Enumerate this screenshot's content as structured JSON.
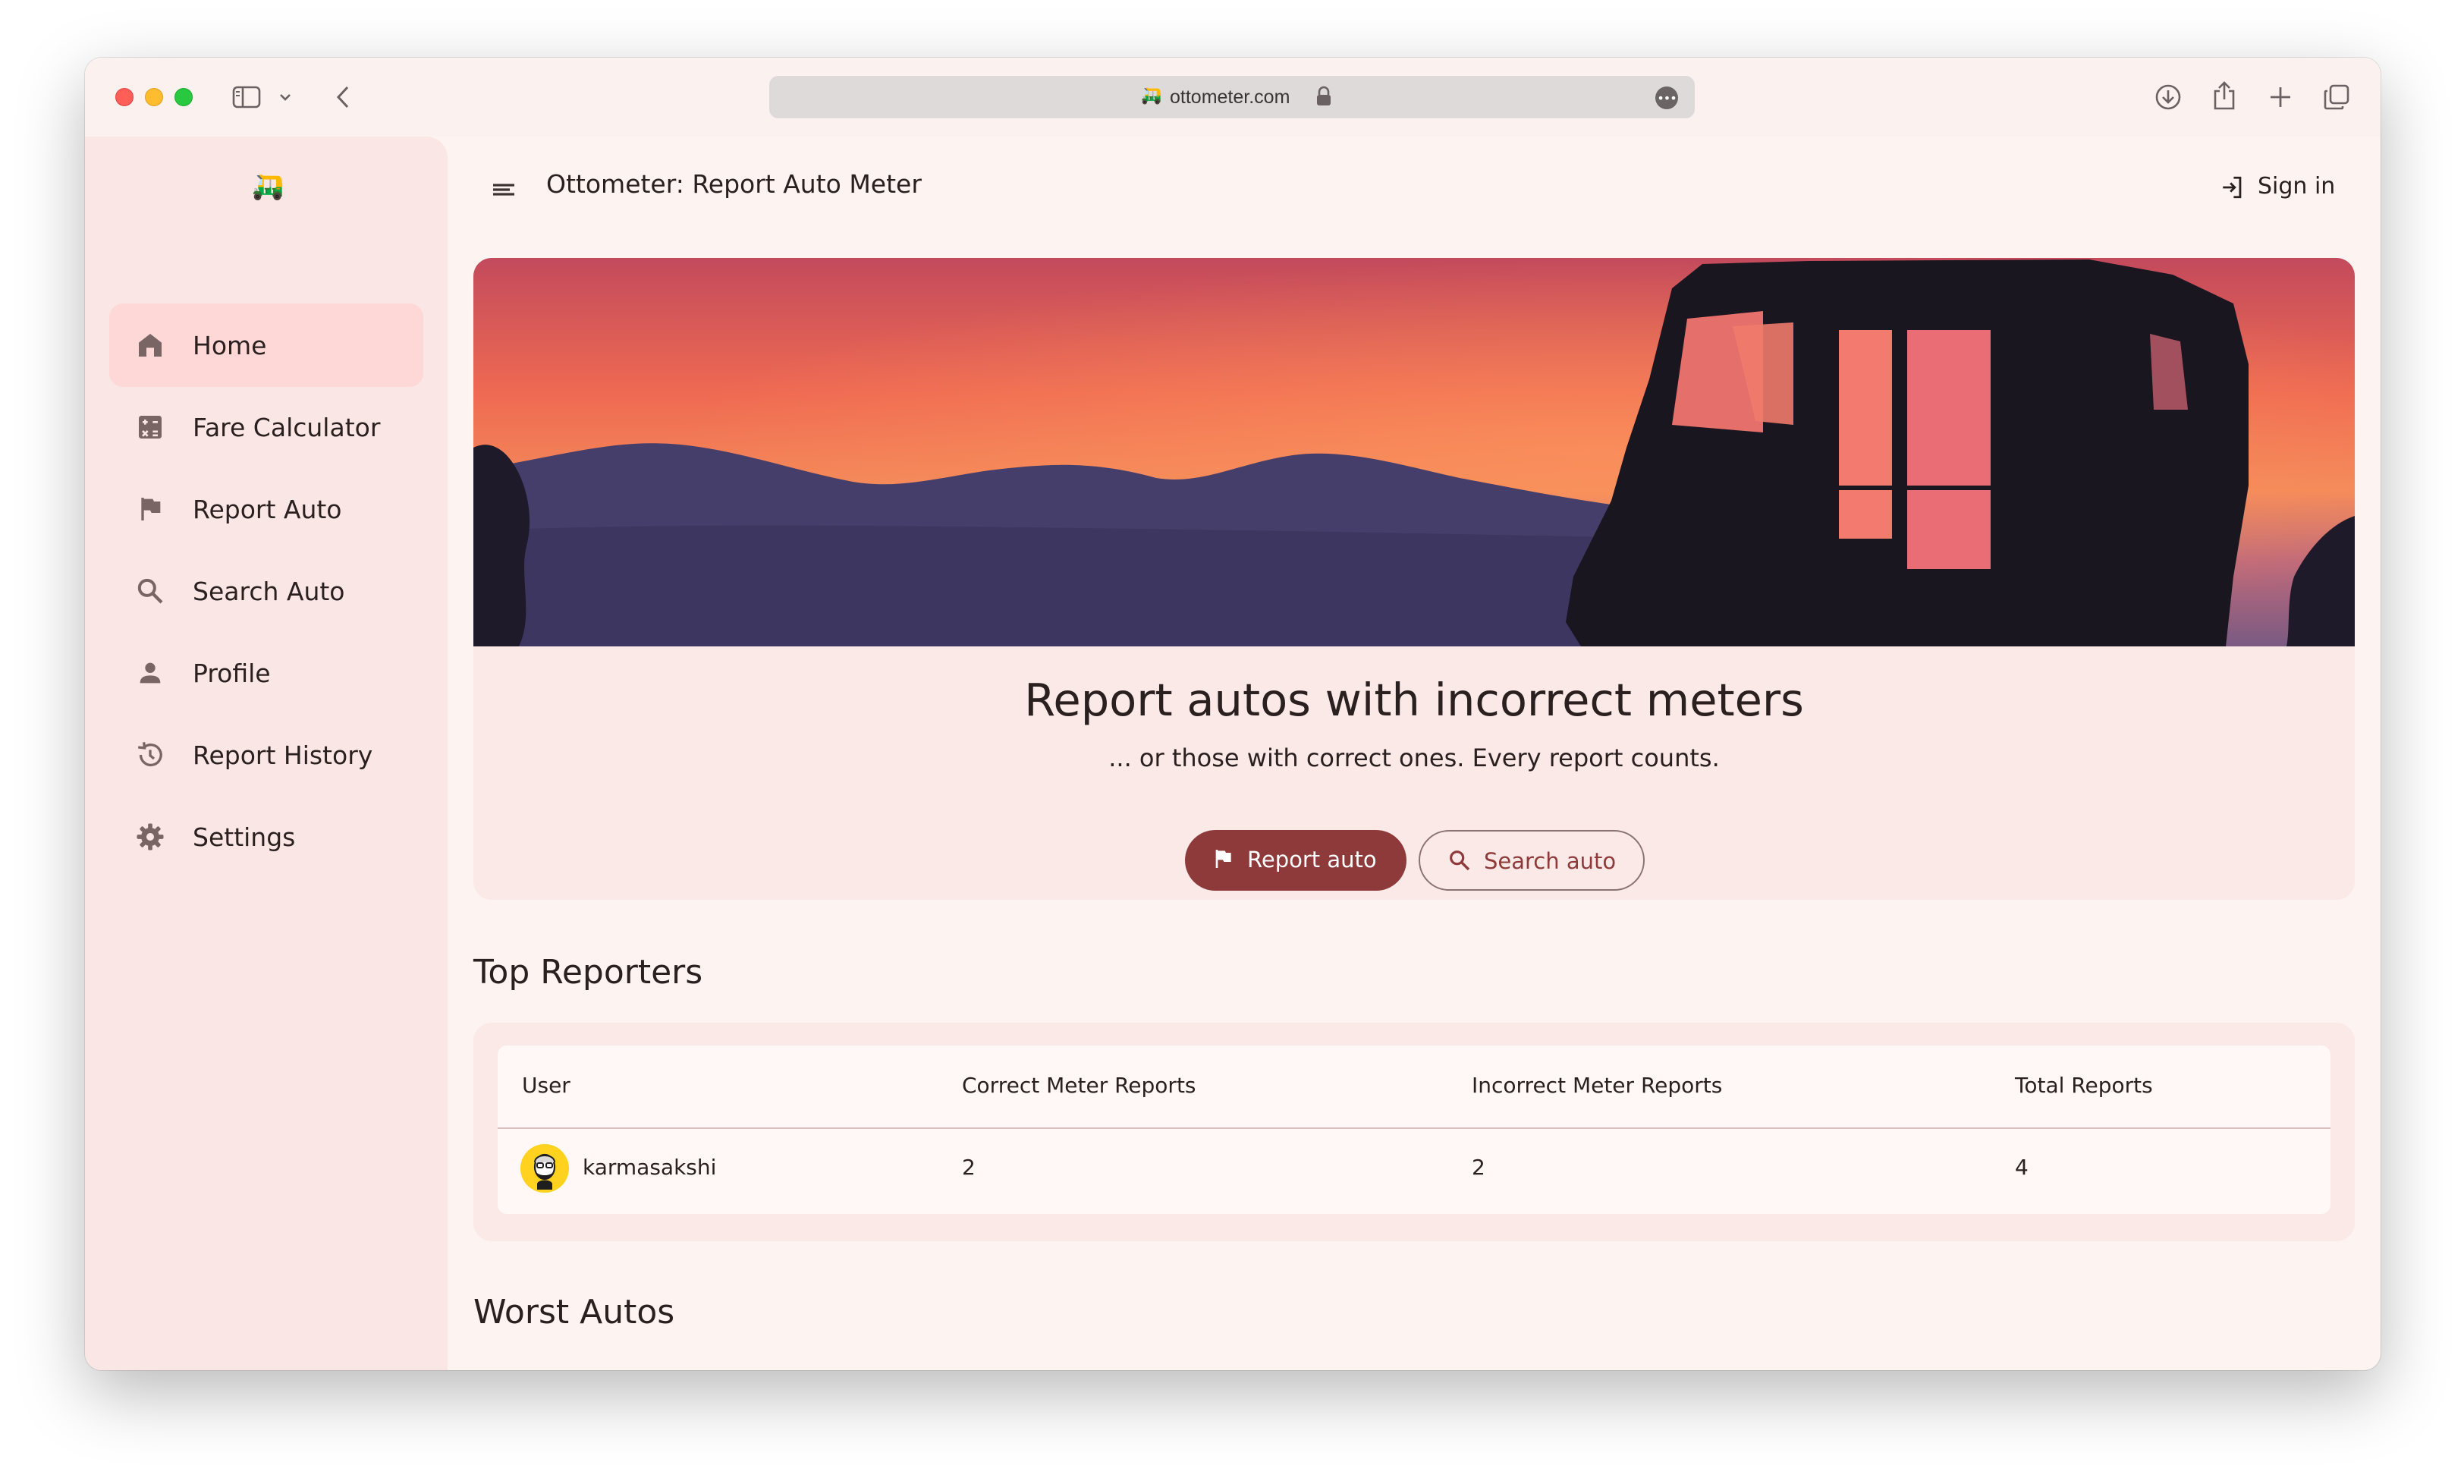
{
  "browser": {
    "url": "ottometer.com"
  },
  "app": {
    "title": "Ottometer: Report Auto Meter",
    "sign_in_label": "Sign in"
  },
  "sidebar": {
    "items": [
      {
        "label": "Home",
        "icon": "home-icon",
        "active": true
      },
      {
        "label": "Fare Calculator",
        "icon": "calculator-icon",
        "active": false
      },
      {
        "label": "Report Auto",
        "icon": "flag-icon",
        "active": false
      },
      {
        "label": "Search Auto",
        "icon": "search-icon",
        "active": false
      },
      {
        "label": "Profile",
        "icon": "person-icon",
        "active": false
      },
      {
        "label": "Report History",
        "icon": "history-icon",
        "active": false
      },
      {
        "label": "Settings",
        "icon": "gear-icon",
        "active": false
      }
    ]
  },
  "hero": {
    "title": "Report autos with incorrect meters",
    "subtitle": "... or those with correct ones. Every report counts.",
    "primary_button": "Report auto",
    "secondary_button": "Search auto"
  },
  "top_reporters": {
    "title": "Top Reporters",
    "columns": [
      "User",
      "Correct Meter Reports",
      "Incorrect Meter Reports",
      "Total Reports"
    ],
    "rows": [
      {
        "user": "karmasakshi",
        "correct": "2",
        "incorrect": "2",
        "total": "4"
      }
    ]
  },
  "worst_autos": {
    "title": "Worst Autos"
  },
  "colors": {
    "primary": "#8f3a3a",
    "background": "#fdf3f1",
    "sidebar": "#fae7e5",
    "nav_active": "#fdd8d6"
  }
}
